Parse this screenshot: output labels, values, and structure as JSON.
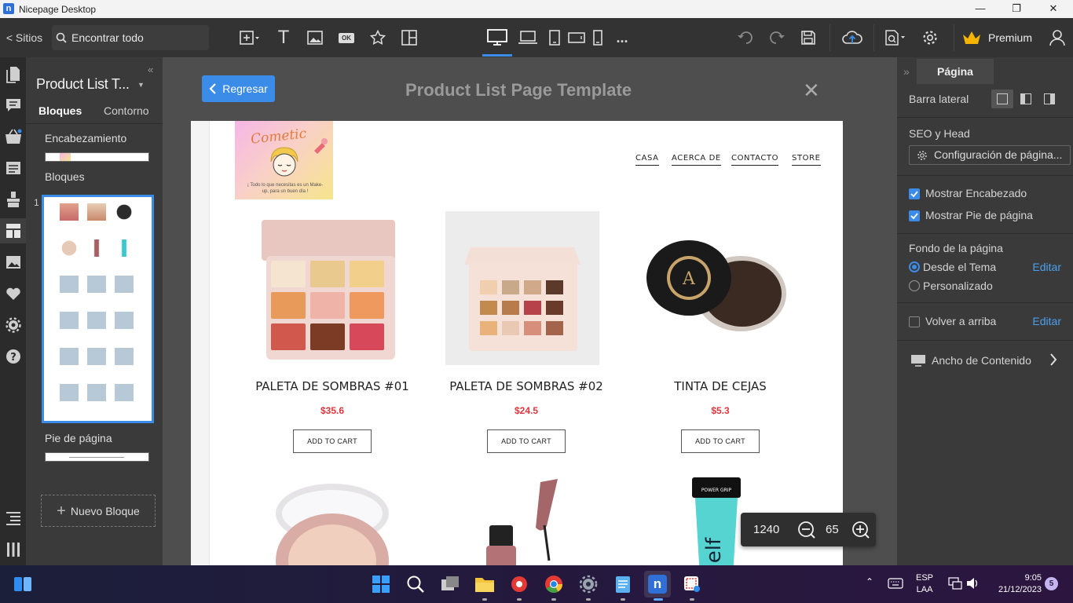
{
  "window": {
    "title": "Nicepage Desktop"
  },
  "toolbar": {
    "sites_label": "< Sitios",
    "search_placeholder": "Encontrar todo",
    "more_label": "...",
    "premium_label": "Premium"
  },
  "left_panel": {
    "title": "Product List T...",
    "tabs": [
      "Bloques",
      "Contorno"
    ],
    "header_label": "Encabezamiento",
    "blocks_label": "Bloques",
    "block_number": "1",
    "footer_label": "Pie de página",
    "new_block_label": "Nuevo Bloque"
  },
  "canvas": {
    "back_label": "Regresar",
    "title": "Product List Page Template",
    "close_symbol": "✕"
  },
  "site": {
    "brand": "Cometic",
    "tagline": "¡ Todo lo que necesitas es un Make-up, para un buen día !",
    "nav": [
      "CASA",
      "ACERCA DE",
      "CONTACTO",
      "STORE"
    ],
    "products": [
      {
        "name": "PALETA DE SOMBRAS #01",
        "price": "$35.6",
        "cart": "ADD TO CART"
      },
      {
        "name": "PALETA DE SOMBRAS #02",
        "price": "$24.5",
        "cart": "ADD TO CART"
      },
      {
        "name": "TINTA DE CEJAS",
        "price": "$5.3",
        "cart": "ADD TO CART"
      }
    ],
    "second_row_products": [
      "highlighter-compact",
      "liquid-lipstick",
      "elf-primer"
    ]
  },
  "zoom": {
    "width": "1240",
    "level": "65"
  },
  "right_panel": {
    "tab_label": "Página",
    "sidebar_label": "Barra lateral",
    "seo_label": "SEO y Head",
    "page_settings_label": "Configuración de página...",
    "show_header_label": "Mostrar Encabezado",
    "show_header_checked": true,
    "show_footer_label": "Mostrar Pie de página",
    "show_footer_checked": true,
    "background_label": "Fondo de la página",
    "bg_theme_label": "Desde el Tema",
    "bg_custom_label": "Personalizado",
    "bg_selected": "Desde el Tema",
    "edit_label": "Editar",
    "back_to_top_label": "Volver a arriba",
    "back_to_top_checked": false,
    "content_width_label": "Ancho de Contenido"
  },
  "taskbar": {
    "lang_top": "ESP",
    "lang_bottom": "LAA",
    "time": "9:05",
    "date": "21/12/2023",
    "notifications": "5"
  },
  "colors": {
    "accent": "#3b8ce8",
    "price": "#e0353d",
    "premium_crown": "#f5b400"
  }
}
